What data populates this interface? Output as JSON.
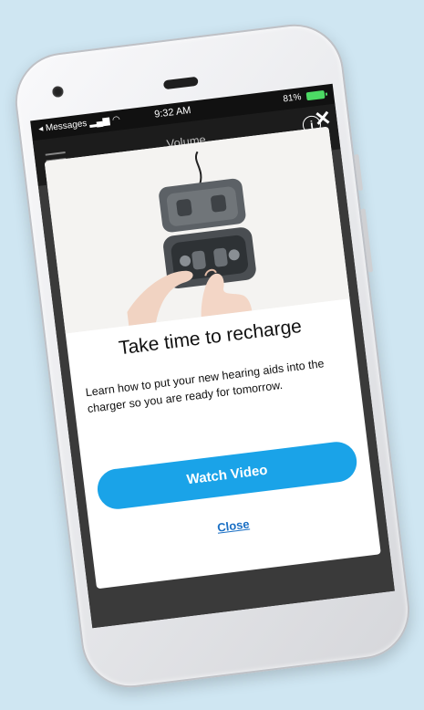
{
  "status_bar": {
    "back_app": "◂ Messages",
    "time": "9:32 AM",
    "battery": "81%"
  },
  "header": {
    "title": "Volume",
    "info_symbol": "i",
    "close_symbol": "✕"
  },
  "modal": {
    "title": "Take time to recharge",
    "description": "Learn how to put your new hearing aids into the charger so you are ready for tomorrow.",
    "primary_button": "Watch Video",
    "close_link": "Close"
  },
  "colors": {
    "accent": "#1aa3e8",
    "link": "#1a6fc4",
    "background": "#cfe6f2"
  }
}
